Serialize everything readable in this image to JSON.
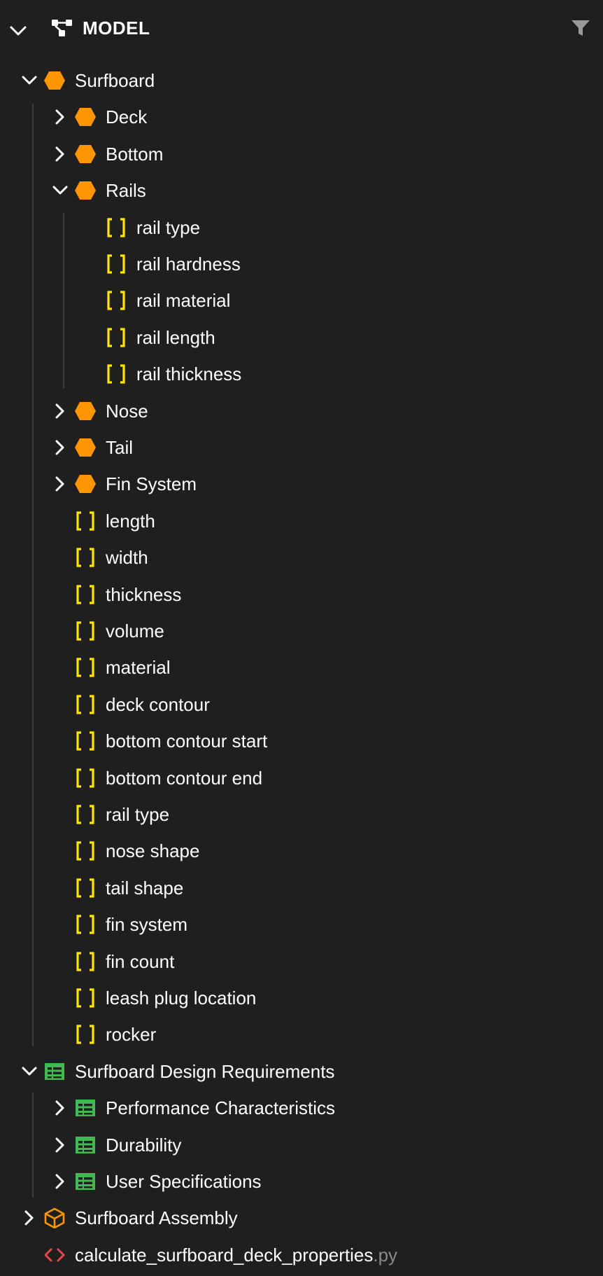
{
  "header": {
    "title": "MODEL",
    "icons": {
      "collapse": "chevron-down-icon",
      "model": "model-graph-icon",
      "filter": "filter-icon"
    }
  },
  "colors": {
    "background": "#1f1f1f",
    "part": "#ff9500",
    "attribute": "#ffe600",
    "requirement": "#3fb950",
    "assembly": "#ff9500",
    "code": "#e5484d",
    "extension": "#8a8a8a"
  },
  "tree": {
    "surfboard": {
      "label": "Surfboard",
      "deck": "Deck",
      "bottom": "Bottom",
      "rails": {
        "label": "Rails",
        "attrs": [
          "rail type",
          "rail hardness",
          "rail material",
          "rail length",
          "rail thickness"
        ]
      },
      "nose": "Nose",
      "tail": "Tail",
      "fin_system": "Fin System",
      "attrs": [
        "length",
        "width",
        "thickness",
        "volume",
        "material",
        "deck contour",
        "bottom contour start",
        "bottom contour end",
        "rail type",
        "nose shape",
        "tail shape",
        "fin system",
        "fin count",
        "leash plug location",
        "rocker"
      ]
    },
    "requirements": {
      "label": "Surfboard Design Requirements",
      "items": [
        "Performance Characteristics",
        "Durability",
        "User Specifications"
      ]
    },
    "assembly": "Surfboard Assembly",
    "script": {
      "name": "calculate_surfboard_deck_properties",
      "ext": ".py"
    }
  }
}
